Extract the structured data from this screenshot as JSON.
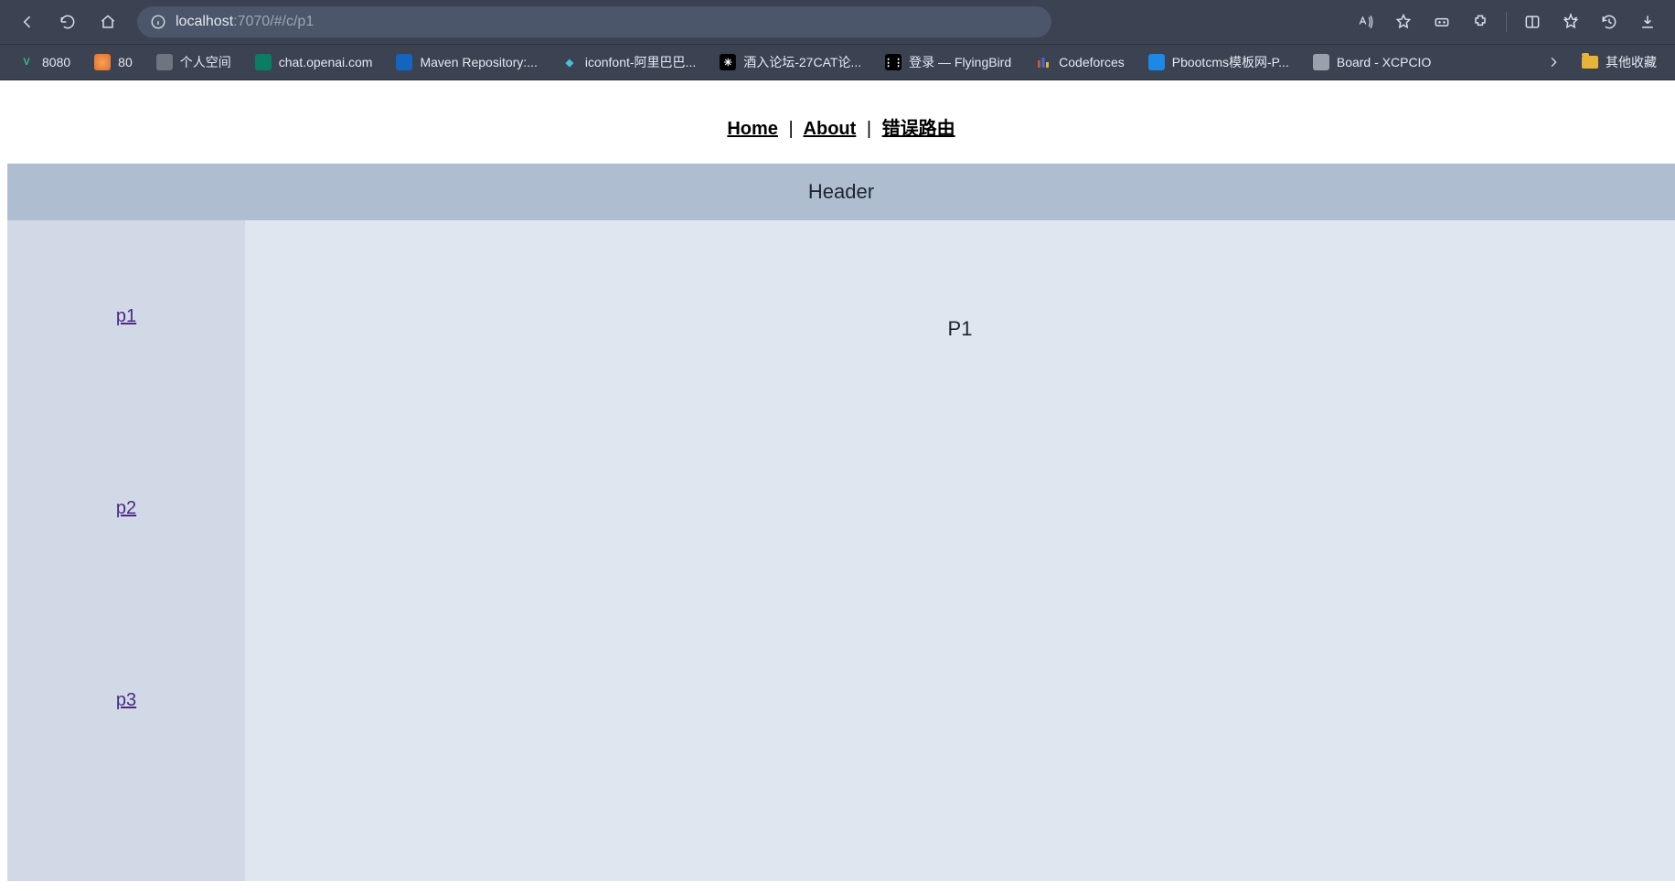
{
  "browser": {
    "url_host": "localhost",
    "url_rest": ":7070/#/c/p1"
  },
  "bookmarks": [
    {
      "label": "8080",
      "favclass": "fav-vue",
      "glyph": "V"
    },
    {
      "label": "80",
      "favclass": "fav-orange",
      "glyph": ""
    },
    {
      "label": "个人空间",
      "favclass": "fav-gray",
      "glyph": ""
    },
    {
      "label": "chat.openai.com",
      "favclass": "fav-green",
      "glyph": ""
    },
    {
      "label": "Maven Repository:...",
      "favclass": "fav-blue",
      "glyph": ""
    },
    {
      "label": "iconfont-阿里巴巴...",
      "favclass": "fav-diamond",
      "glyph": "◆"
    },
    {
      "label": "酒入论坛-27CAT论...",
      "favclass": "fav-bug",
      "glyph": "✳"
    },
    {
      "label": "登录 — FlyingBird",
      "favclass": "fav-dots",
      "glyph": "⋮⋮"
    },
    {
      "label": "Codeforces",
      "favclass": "fav-bars",
      "glyph": ""
    },
    {
      "label": "Pbootcms模板网-P...",
      "favclass": "fav-bluec",
      "glyph": ""
    },
    {
      "label": "Board - XCPCIO",
      "favclass": "fav-graycirc",
      "glyph": ""
    }
  ],
  "bookmarks_overflow_label": "其他收藏",
  "page": {
    "nav": {
      "home": "Home",
      "about": "About",
      "error": "错误路由",
      "sep": "|"
    },
    "header": "Header",
    "sidebar": [
      {
        "label": "p1"
      },
      {
        "label": "p2"
      },
      {
        "label": "p3"
      }
    ],
    "content_title": "P1"
  }
}
